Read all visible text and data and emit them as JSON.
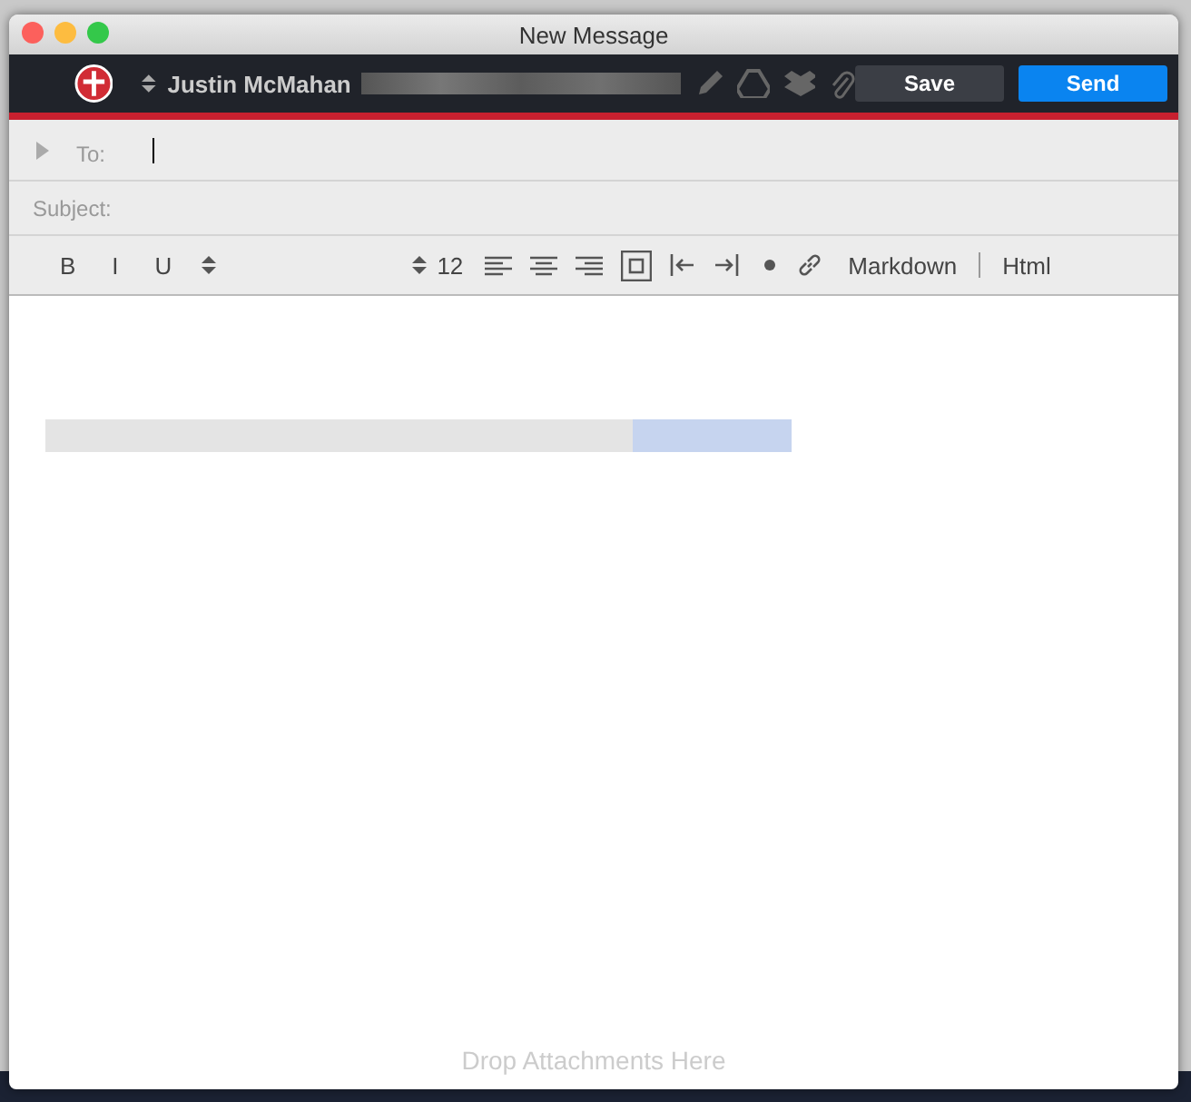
{
  "window": {
    "title": "New Message"
  },
  "toolbar": {
    "account": "Justin McMahan",
    "buttons": [
      {
        "label": "Save",
        "kind": "secondary"
      },
      {
        "label": "Send",
        "kind": "primary"
      }
    ]
  },
  "fields": [
    {
      "label": "To:",
      "kind": "recipients"
    },
    {
      "label": "Subject:",
      "kind": "subject"
    }
  ],
  "format_bar": {
    "styles": [
      "B",
      "I",
      "U"
    ],
    "font_size": "12",
    "modes": [
      "Markdown",
      "Html"
    ]
  },
  "body": {
    "drop_hint": "Drop Attachments Here"
  }
}
